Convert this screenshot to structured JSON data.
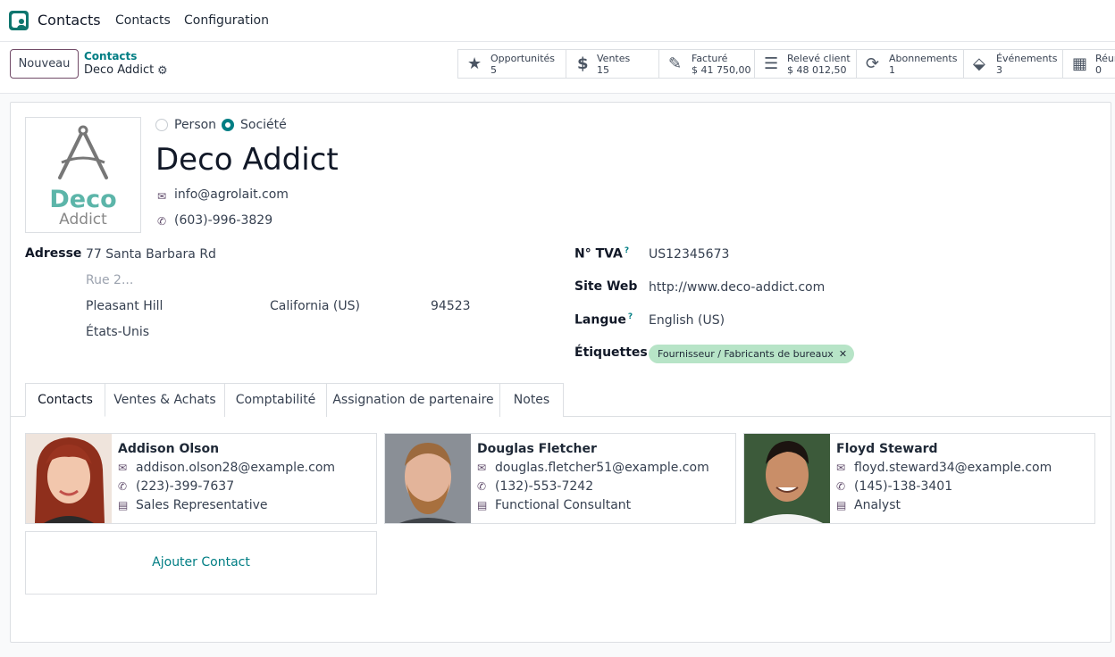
{
  "app": {
    "name": "Contacts",
    "icon": "contacts-app-icon"
  },
  "nav": {
    "contacts": "Contacts",
    "configuration": "Configuration"
  },
  "control_panel": {
    "new_button": "Nouveau",
    "breadcrumb_parent": "Contacts",
    "breadcrumb_current": "Deco Addict",
    "gear_icon": "gear-icon"
  },
  "smart_buttons": [
    {
      "icon": "star-icon",
      "label": "Opportunités",
      "value": "5"
    },
    {
      "icon": "dollar-icon",
      "label": "Ventes",
      "value": "15"
    },
    {
      "icon": "pencil-square-icon",
      "label": "Facturé",
      "value": "$ 41 750,00"
    },
    {
      "icon": "list-icon",
      "label": "Relevé client",
      "value": "$ 48 012,50"
    },
    {
      "icon": "refresh-icon",
      "label": "Abonnements",
      "value": "1"
    },
    {
      "icon": "ticket-icon",
      "label": "Événements",
      "value": "3"
    },
    {
      "icon": "calendar-icon",
      "label": "Réun",
      "value": "0"
    }
  ],
  "partner": {
    "type_person": "Person",
    "type_company": "Société",
    "selected_type": "company",
    "name": "Deco Addict",
    "email": "info@agrolait.com",
    "phone": "(603)-996-3829",
    "logo_text_1": "Deco",
    "logo_text_2": "Addict",
    "logo_color": "#5cb5a9"
  },
  "address": {
    "label": "Adresse",
    "street": "77 Santa Barbara Rd",
    "street2_placeholder": "Rue 2...",
    "city": "Pleasant Hill",
    "state": "California (US)",
    "zip": "94523",
    "country": "États-Unis"
  },
  "fields": {
    "vat_label": "N° TVA",
    "vat_help": "?",
    "vat": "US12345673",
    "website_label": "Site Web",
    "website": "http://www.deco-addict.com",
    "lang_label": "Langue",
    "lang_help": "?",
    "lang": "English (US)",
    "tags_label": "Étiquettes",
    "tag": "Fournisseur / Fabricants de bureaux",
    "tag_remove": "✕",
    "tag_color": "#b7e4c7"
  },
  "tabs": [
    {
      "label": "Contacts",
      "active": true
    },
    {
      "label": "Ventes & Achats",
      "active": false
    },
    {
      "label": "Comptabilité",
      "active": false
    },
    {
      "label": "Assignation de partenaire",
      "active": false
    },
    {
      "label": "Notes",
      "active": false
    }
  ],
  "contacts": [
    {
      "name": "Addison Olson",
      "email": "addison.olson28@example.com",
      "phone": "(223)-399-7637",
      "job": "Sales Representative"
    },
    {
      "name": "Douglas Fletcher",
      "email": "douglas.fletcher51@example.com",
      "phone": "(132)-553-7242",
      "job": "Functional Consultant"
    },
    {
      "name": "Floyd Steward",
      "email": "floyd.steward34@example.com",
      "phone": "(145)-138-3401",
      "job": "Analyst"
    }
  ],
  "add_contact": "Ajouter Contact",
  "colors": {
    "primary": "#714b67",
    "link": "#017e84"
  }
}
